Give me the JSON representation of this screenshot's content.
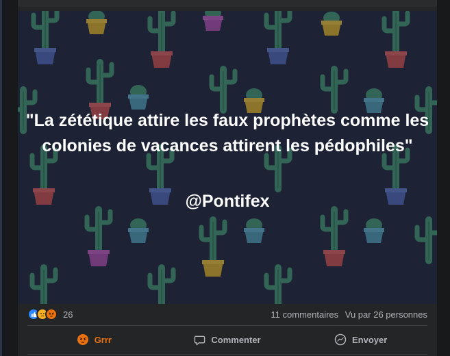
{
  "post": {
    "quote": "\"La zététique attire les faux prophètes comme les colonies de vacances attirent les pédophiles\"",
    "author": "@Pontifex",
    "reactions": {
      "count": "26",
      "icons": [
        "like-icon",
        "sad-icon",
        "angry-icon"
      ]
    },
    "comments_label": "11 commentaires",
    "views_label": "Vu par 26 personnes"
  },
  "actions": {
    "react_label": "Grrr",
    "comment_label": "Commenter",
    "send_label": "Envoyer"
  },
  "colors": {
    "background": "#18191a",
    "card": "#242526",
    "image_bg": "#1f2436",
    "secondary_text": "#b0b3b8",
    "angry_accent": "#e9710f",
    "like_blue": "#2d88ff"
  }
}
